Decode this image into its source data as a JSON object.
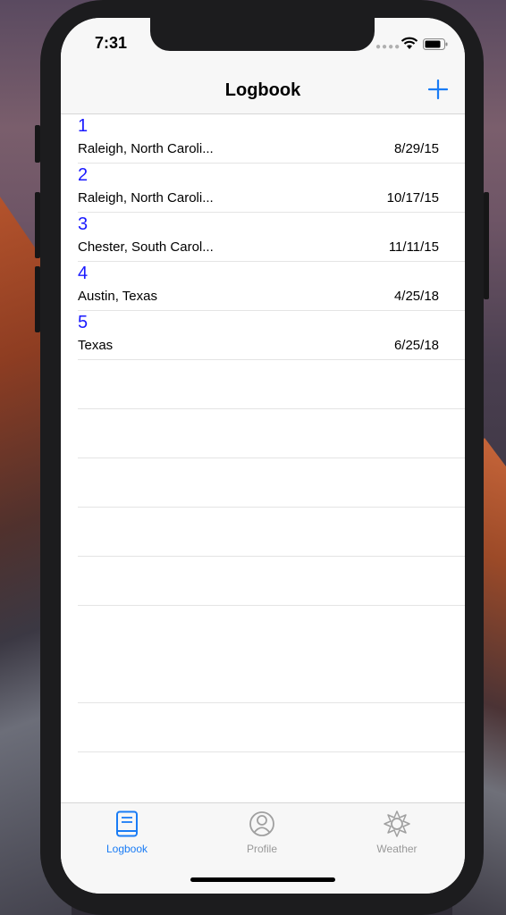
{
  "status": {
    "time": "7:31"
  },
  "nav": {
    "title": "Logbook"
  },
  "entries": [
    {
      "number": "1",
      "location": "Raleigh, North Caroli...",
      "date": "8/29/15"
    },
    {
      "number": "2",
      "location": "Raleigh, North Caroli...",
      "date": "10/17/15"
    },
    {
      "number": "3",
      "location": "Chester, South Carol...",
      "date": "11/11/15"
    },
    {
      "number": "4",
      "location": "Austin, Texas",
      "date": "4/25/18"
    },
    {
      "number": "5",
      "location": "Texas",
      "date": "6/25/18"
    }
  ],
  "tabs": [
    {
      "label": "Logbook",
      "icon": "book-icon",
      "active": true
    },
    {
      "label": "Profile",
      "icon": "person-icon",
      "active": false
    },
    {
      "label": "Weather",
      "icon": "sun-icon",
      "active": false
    }
  ],
  "colors": {
    "accent": "#1a7cf5",
    "entry_number": "#1a1aff",
    "inactive_tab": "#999999"
  }
}
